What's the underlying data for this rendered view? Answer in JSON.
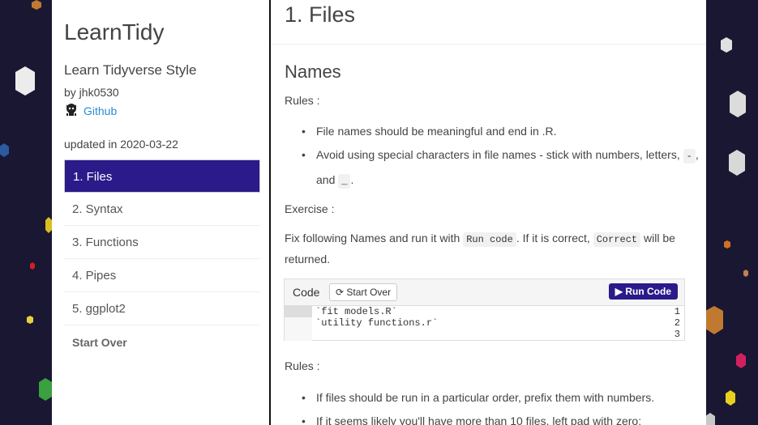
{
  "sidebar": {
    "title": "LearnTidy",
    "subtitle": "Learn Tidyverse Style",
    "author": "by jhk0530",
    "github_label": "Github",
    "updated": "updated in 2020-03-22",
    "nav": [
      {
        "label": "1. Files",
        "active": true
      },
      {
        "label": "2. Syntax",
        "active": false
      },
      {
        "label": "3. Functions",
        "active": false
      },
      {
        "label": "4. Pipes",
        "active": false
      },
      {
        "label": "5. ggplot2",
        "active": false
      }
    ],
    "start_over": "Start Over"
  },
  "main": {
    "page_title": "1. Files",
    "section_title": "Names",
    "rules_label": "Rules :",
    "rule1": "File names should be meaningful and end in .R.",
    "rule2_pre": "Avoid using special characters in file names - stick with numbers, letters,",
    "rule2_code1": "-",
    "rule2_comma": ",",
    "rule2_and": "and",
    "rule2_code2": "_",
    "rule2_end": ".",
    "exercise_label": "Exercise :",
    "exercise_pre": "Fix following Names and run it with",
    "exercise_code1": "Run code",
    "exercise_mid": ". If it is correct,",
    "exercise_code2": "Correct",
    "exercise_post": "will be",
    "exercise_line2": "returned.",
    "code_panel": {
      "label": "Code",
      "start_over_btn": "Start Over",
      "run_btn": "Run Code",
      "line_numbers": [
        "1",
        "2",
        "3"
      ],
      "lines": [
        "`fit models.R`",
        "`utility functions.r`",
        ""
      ]
    },
    "rules2_label": "Rules :",
    "rules2": [
      "If files should be run in a particular order, prefix them with numbers.",
      "If it seems likely you'll have more than 10 files, left pad with zero:"
    ]
  },
  "colors": {
    "background": "#1a1733",
    "accent": "#2a1a8a",
    "link": "#2a8bd4"
  }
}
